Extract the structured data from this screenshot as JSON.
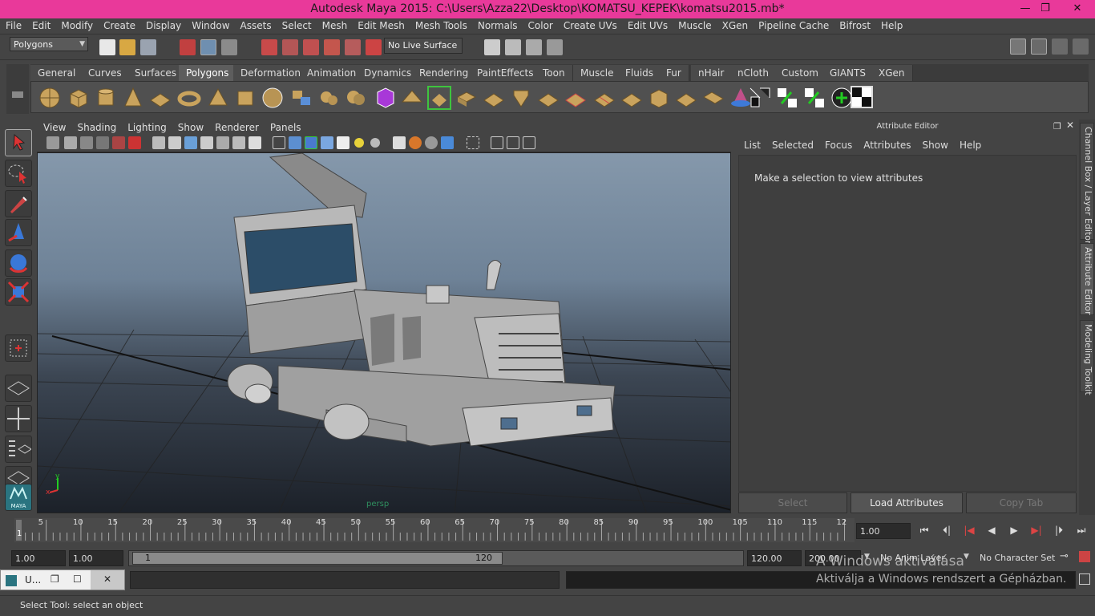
{
  "window": {
    "title": "Autodesk Maya 2015: C:\\Users\\Azza22\\Desktop\\KOMATSU_KEPEK\\komatsu2015.mb*",
    "minimize": "—",
    "maximize": "❐",
    "close": "✕"
  },
  "menubar": [
    "File",
    "Edit",
    "Modify",
    "Create",
    "Display",
    "Window",
    "Assets",
    "Select",
    "Mesh",
    "Edit Mesh",
    "Mesh Tools",
    "Normals",
    "Color",
    "Create UVs",
    "Edit UVs",
    "Muscle",
    "XGen",
    "Pipeline Cache",
    "Bifrost",
    "Help"
  ],
  "statusline": {
    "menuset": "Polygons",
    "live_surface": "No Live Surface"
  },
  "shelf_tabs": [
    "General",
    "Curves",
    "Surfaces",
    "Polygons",
    "Deformation",
    "Animation",
    "Dynamics",
    "Rendering",
    "PaintEffects",
    "Toon",
    "Muscle",
    "Fluids",
    "Fur",
    "nHair",
    "nCloth",
    "Custom",
    "GIANTS",
    "XGen"
  ],
  "shelf_active": "Polygons",
  "viewport": {
    "menu": [
      "View",
      "Shading",
      "Lighting",
      "Show",
      "Renderer",
      "Panels"
    ],
    "camera_label": "persp",
    "axis_x": "x",
    "axis_y": "y"
  },
  "attribute_editor": {
    "title": "Attribute Editor",
    "menu": [
      "List",
      "Selected",
      "Focus",
      "Attributes",
      "Show",
      "Help"
    ],
    "message": "Make a selection to view attributes",
    "buttons": {
      "select": "Select",
      "load": "Load Attributes",
      "copy": "Copy Tab"
    }
  },
  "side_tabs": [
    "Channel Box / Layer Editor",
    "Attribute Editor",
    "Modeling Toolkit"
  ],
  "timeline": {
    "ticks": [
      "5",
      "10",
      "15",
      "20",
      "25",
      "30",
      "35",
      "40",
      "45",
      "50",
      "55",
      "60",
      "65",
      "70",
      "75",
      "80",
      "85",
      "90",
      "95",
      "100",
      "105",
      "110",
      "115",
      "12"
    ],
    "current_frame_marker": "1",
    "current_time": "1.00"
  },
  "range": {
    "start": "1.00",
    "anim_start": "1.00",
    "slider_start": "1",
    "slider_end": "120",
    "anim_end": "120.00",
    "end": "200.00",
    "anim_layer": "No Anim Layer",
    "character_set": "No Character Set"
  },
  "taskbar_item": "U...",
  "watermark": {
    "line1": "A Windows aktiválása",
    "line2": "Aktiválja a Windows rendszert a Gépházban."
  },
  "help_line": "Select Tool: select an object",
  "maya_logo": "MAYA"
}
